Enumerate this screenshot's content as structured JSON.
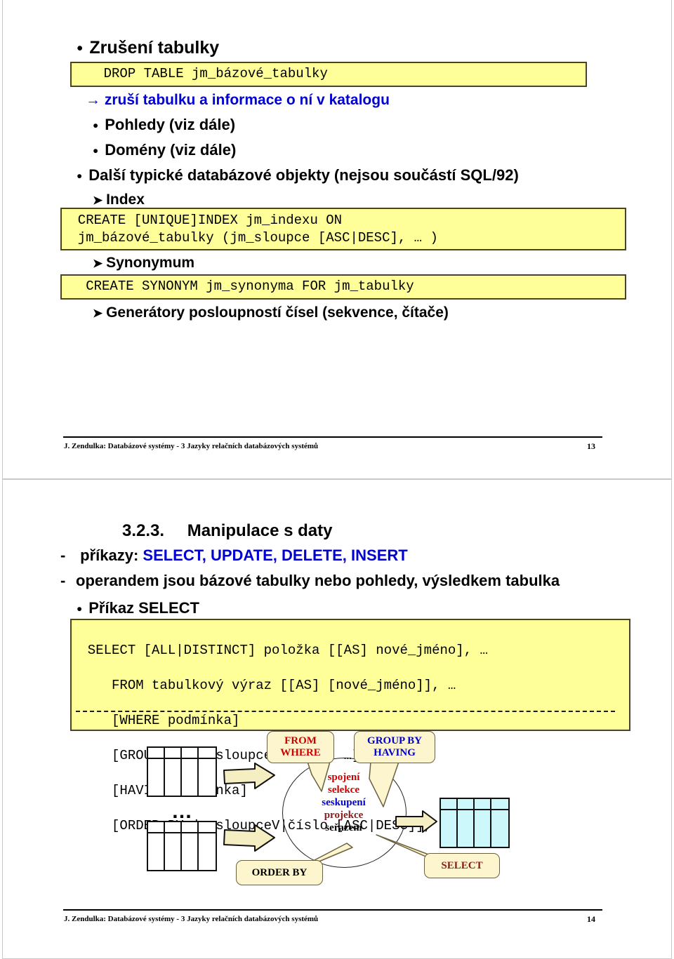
{
  "slide13": {
    "bullets": {
      "zruseni": "Zrušení tabulky",
      "arrow_note": "→ zruší tabulku a informace o ní v katalogu",
      "pohledy": "Pohledy (viz dále)",
      "domeny": "Domény (viz dále)",
      "dalsi": "Další typické databázové objekty (nejsou součástí SQL/92)",
      "index": "Index",
      "synonymum": "Synonymum",
      "generatory": "Generátory posloupností čísel (sekvence, čítače)"
    },
    "code": {
      "drop_table": "    DROP TABLE jm_bázové_tabulky",
      "create_index": "  CREATE [UNIQUE]INDEX jm_indexu ON\n  jm_bázové_tabulky (jm_sloupce [ASC|DESC], … )",
      "create_synonym": "   CREATE SYNONYM jm_synonyma FOR jm_tabulky"
    },
    "footer": {
      "text": "J. Zendulka: Databázové systémy - 3 Jazyky relačních databázových systémů",
      "page": "13"
    }
  },
  "slide14": {
    "heading_number": "3.2.3.",
    "heading_title": "Manipulace s daty",
    "line_prikazy_label": "příkazy: ",
    "line_prikazy_commands": "SELECT, UPDATE, DELETE, INSERT",
    "line_operandem": "operandem jsou bázové tabulky nebo pohledy, výsledkem tabulka",
    "bullet_prikaz_select": "Příkaz SELECT",
    "select_syntax": {
      "l1": "  SELECT [ALL|DISTINCT] položka [[AS] nové_jméno], …",
      "l2": "     FROM tabulkový výraz [[AS] [nové_jméno]], …",
      "l3": "     [WHERE podmínka]",
      "l4": "     [GROUP BY jm_sloupceZ|číslo, …]",
      "l5": "     [HAVING podmínka]",
      "l6": "     [ORDER BY jm_sloupceV|číslo [ASC|DESC]], …"
    },
    "diagram": {
      "dots": "…",
      "ellipse_ops": [
        {
          "label": "spojení",
          "color": "#cc0000"
        },
        {
          "label": "selekce",
          "color": "#cc0000"
        },
        {
          "label": "seskupení",
          "color": "#0000d0"
        },
        {
          "label": "projekce",
          "color": "#8b1a1a"
        },
        {
          "label": "seřazení",
          "color": "#000000"
        }
      ],
      "callouts": [
        {
          "name": "from-where",
          "text": "FROM\nWHERE",
          "color": "#cc0000"
        },
        {
          "name": "group-by-having",
          "text": "GROUP BY\nHAVING",
          "color": "#0000d0"
        },
        {
          "name": "order-by",
          "text": "ORDER BY",
          "color": "#000000"
        },
        {
          "name": "select",
          "text": "SELECT",
          "color": "#8b1a1a"
        }
      ]
    },
    "footer": {
      "text": "J. Zendulka: Databázové systémy - 3 Jazyky relačních databázových systémů",
      "page": "14"
    }
  },
  "colors": {
    "code_bg": "#ffff99",
    "code_border": "#4c4226",
    "callout_bg": "#fdf5cd",
    "result_table": "#ccf7fb",
    "arrow_fill": "#f5eec2",
    "accent_blue": "#0000d0",
    "accent_red": "#cc0000",
    "accent_darkred": "#8b1a1a"
  }
}
